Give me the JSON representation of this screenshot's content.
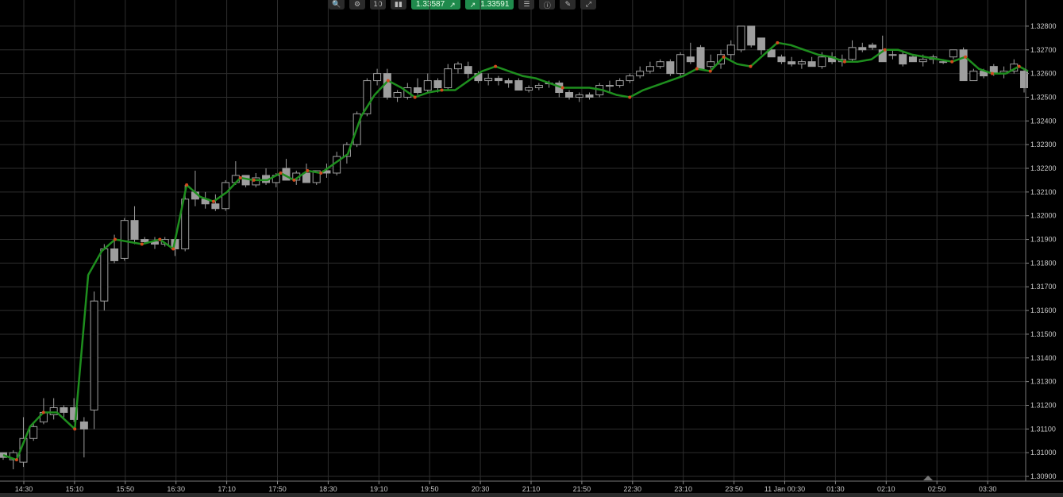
{
  "toolbar": {
    "zoom_icon": "magnifier-icon",
    "settings_icon": "chart-settings-icon",
    "timeframe_label": "10",
    "candles_icon": "candles-icon",
    "sell_price": "1.33587",
    "buy_price": "1.33591",
    "list_icon": "checklist-icon",
    "info_icon": "info-icon",
    "tools_icon": "drawing-tools-icon",
    "expand_icon": "expand-icon"
  },
  "colors": {
    "background": "#000000",
    "grid": "#2e2e2e",
    "candle": "#9e9e9e",
    "line": "#1e8e1e",
    "marker": "#d24a1e",
    "axis_text": "#c8c8c8",
    "price_button": "#1f8a4c"
  },
  "chart_data": {
    "type": "candlestick",
    "x_ticks": [
      "14:30",
      "15:10",
      "15:50",
      "16:30",
      "17:10",
      "17:50",
      "18:30",
      "19:10",
      "19:50",
      "20:30",
      "21:10",
      "21:50",
      "22:30",
      "23:10",
      "23:50",
      "11 Jan 00:30",
      "01:30",
      "02:10",
      "02:50",
      "03:30"
    ],
    "y_ticks": [
      "1.32800",
      "1.32700",
      "1.32600",
      "1.32500",
      "1.32400",
      "1.32300",
      "1.32200",
      "1.32100",
      "1.32000",
      "1.31900",
      "1.31800",
      "1.31700",
      "1.31600",
      "1.31500",
      "1.31400",
      "1.31300",
      "1.31200",
      "1.31100",
      "1.31000",
      "1.30900"
    ],
    "ylim": [
      1.3088,
      1.3285
    ],
    "grid": true,
    "candles": [
      {
        "o": 1.31,
        "h": 1.31,
        "l": 1.3097,
        "c": 1.3098
      },
      {
        "o": 1.3097,
        "h": 1.3101,
        "l": 1.3093,
        "c": 1.31
      },
      {
        "o": 1.3096,
        "h": 1.3115,
        "l": 1.3094,
        "c": 1.3106
      },
      {
        "o": 1.3106,
        "h": 1.3113,
        "l": 1.3105,
        "c": 1.3111
      },
      {
        "o": 1.3113,
        "h": 1.3123,
        "l": 1.3112,
        "c": 1.3117
      },
      {
        "o": 1.3116,
        "h": 1.3123,
        "l": 1.3114,
        "c": 1.3119
      },
      {
        "o": 1.3119,
        "h": 1.312,
        "l": 1.3115,
        "c": 1.3117
      },
      {
        "o": 1.3119,
        "h": 1.3123,
        "l": 1.3113,
        "c": 1.3114
      },
      {
        "o": 1.3113,
        "h": 1.3115,
        "l": 1.3098,
        "c": 1.311
      },
      {
        "o": 1.3118,
        "h": 1.3168,
        "l": 1.311,
        "c": 1.3164
      },
      {
        "o": 1.3164,
        "h": 1.3188,
        "l": 1.316,
        "c": 1.3186
      },
      {
        "o": 1.3186,
        "h": 1.3192,
        "l": 1.318,
        "c": 1.3181
      },
      {
        "o": 1.3182,
        "h": 1.3199,
        "l": 1.3181,
        "c": 1.3198
      },
      {
        "o": 1.3198,
        "h": 1.3204,
        "l": 1.3188,
        "c": 1.319
      },
      {
        "o": 1.319,
        "h": 1.3191,
        "l": 1.3188,
        "c": 1.3189
      },
      {
        "o": 1.3189,
        "h": 1.3191,
        "l": 1.3186,
        "c": 1.3188
      },
      {
        "o": 1.3188,
        "h": 1.3191,
        "l": 1.3187,
        "c": 1.319
      },
      {
        "o": 1.319,
        "h": 1.3191,
        "l": 1.3183,
        "c": 1.3186
      },
      {
        "o": 1.3186,
        "h": 1.3213,
        "l": 1.3185,
        "c": 1.3207
      },
      {
        "o": 1.321,
        "h": 1.3219,
        "l": 1.3204,
        "c": 1.3207
      },
      {
        "o": 1.3207,
        "h": 1.321,
        "l": 1.3203,
        "c": 1.3205
      },
      {
        "o": 1.3205,
        "h": 1.3209,
        "l": 1.3202,
        "c": 1.3203
      },
      {
        "o": 1.3203,
        "h": 1.3215,
        "l": 1.3202,
        "c": 1.3214
      },
      {
        "o": 1.3214,
        "h": 1.3223,
        "l": 1.3213,
        "c": 1.3217
      },
      {
        "o": 1.3217,
        "h": 1.3217,
        "l": 1.3212,
        "c": 1.3213
      },
      {
        "o": 1.3213,
        "h": 1.3218,
        "l": 1.3212,
        "c": 1.3216
      },
      {
        "o": 1.3217,
        "h": 1.322,
        "l": 1.3213,
        "c": 1.3214
      },
      {
        "o": 1.3214,
        "h": 1.3218,
        "l": 1.3212,
        "c": 1.3217
      },
      {
        "o": 1.322,
        "h": 1.3224,
        "l": 1.3215,
        "c": 1.3215
      },
      {
        "o": 1.3215,
        "h": 1.3219,
        "l": 1.3213,
        "c": 1.3218
      },
      {
        "o": 1.3218,
        "h": 1.3222,
        "l": 1.3214,
        "c": 1.3214
      },
      {
        "o": 1.3214,
        "h": 1.3219,
        "l": 1.3213,
        "c": 1.3219
      },
      {
        "o": 1.3219,
        "h": 1.3222,
        "l": 1.3216,
        "c": 1.3218
      },
      {
        "o": 1.3218,
        "h": 1.3227,
        "l": 1.3217,
        "c": 1.3225
      },
      {
        "o": 1.3225,
        "h": 1.3231,
        "l": 1.3222,
        "c": 1.323
      },
      {
        "o": 1.323,
        "h": 1.3244,
        "l": 1.3229,
        "c": 1.3243
      },
      {
        "o": 1.3243,
        "h": 1.3258,
        "l": 1.3242,
        "c": 1.3257
      },
      {
        "o": 1.3257,
        "h": 1.3262,
        "l": 1.3255,
        "c": 1.326
      },
      {
        "o": 1.326,
        "h": 1.3262,
        "l": 1.3249,
        "c": 1.325
      },
      {
        "o": 1.325,
        "h": 1.3253,
        "l": 1.3248,
        "c": 1.3252
      },
      {
        "o": 1.325,
        "h": 1.3256,
        "l": 1.3249,
        "c": 1.3254
      },
      {
        "o": 1.3254,
        "h": 1.3258,
        "l": 1.3251,
        "c": 1.3252
      },
      {
        "o": 1.3253,
        "h": 1.326,
        "l": 1.3252,
        "c": 1.3257
      },
      {
        "o": 1.3257,
        "h": 1.3258,
        "l": 1.3252,
        "c": 1.3254
      },
      {
        "o": 1.3254,
        "h": 1.3264,
        "l": 1.3253,
        "c": 1.3262
      },
      {
        "o": 1.3262,
        "h": 1.3265,
        "l": 1.326,
        "c": 1.3264
      },
      {
        "o": 1.3263,
        "h": 1.3265,
        "l": 1.3258,
        "c": 1.326
      },
      {
        "o": 1.326,
        "h": 1.3261,
        "l": 1.3256,
        "c": 1.3257
      },
      {
        "o": 1.3257,
        "h": 1.326,
        "l": 1.3255,
        "c": 1.3258
      },
      {
        "o": 1.3258,
        "h": 1.3259,
        "l": 1.3255,
        "c": 1.3257
      },
      {
        "o": 1.3257,
        "h": 1.3258,
        "l": 1.3254,
        "c": 1.3256
      },
      {
        "o": 1.3257,
        "h": 1.3258,
        "l": 1.3253,
        "c": 1.3253
      },
      {
        "o": 1.3253,
        "h": 1.3255,
        "l": 1.3252,
        "c": 1.3254
      },
      {
        "o": 1.3254,
        "h": 1.3256,
        "l": 1.3253,
        "c": 1.3255
      },
      {
        "o": 1.3256,
        "h": 1.3257,
        "l": 1.3254,
        "c": 1.3256
      },
      {
        "o": 1.3256,
        "h": 1.3257,
        "l": 1.325,
        "c": 1.3252
      },
      {
        "o": 1.3252,
        "h": 1.3253,
        "l": 1.3249,
        "c": 1.325
      },
      {
        "o": 1.325,
        "h": 1.3252,
        "l": 1.3248,
        "c": 1.3251
      },
      {
        "o": 1.3251,
        "h": 1.3252,
        "l": 1.3249,
        "c": 1.325
      },
      {
        "o": 1.3251,
        "h": 1.3256,
        "l": 1.325,
        "c": 1.3255
      },
      {
        "o": 1.3255,
        "h": 1.3257,
        "l": 1.3252,
        "c": 1.3255
      },
      {
        "o": 1.3255,
        "h": 1.3258,
        "l": 1.3254,
        "c": 1.3257
      },
      {
        "o": 1.3257,
        "h": 1.326,
        "l": 1.3256,
        "c": 1.3259
      },
      {
        "o": 1.3259,
        "h": 1.3263,
        "l": 1.3258,
        "c": 1.3261
      },
      {
        "o": 1.3261,
        "h": 1.3265,
        "l": 1.326,
        "c": 1.3263
      },
      {
        "o": 1.3263,
        "h": 1.3266,
        "l": 1.3262,
        "c": 1.3265
      },
      {
        "o": 1.3265,
        "h": 1.3266,
        "l": 1.3259,
        "c": 1.326
      },
      {
        "o": 1.326,
        "h": 1.3269,
        "l": 1.3259,
        "c": 1.3268
      },
      {
        "o": 1.3267,
        "h": 1.3273,
        "l": 1.3264,
        "c": 1.3265
      },
      {
        "o": 1.3271,
        "h": 1.3272,
        "l": 1.3262,
        "c": 1.3262
      },
      {
        "o": 1.3263,
        "h": 1.3268,
        "l": 1.3262,
        "c": 1.3265
      },
      {
        "o": 1.3264,
        "h": 1.327,
        "l": 1.3262,
        "c": 1.3268
      },
      {
        "o": 1.3268,
        "h": 1.3274,
        "l": 1.3266,
        "c": 1.3272
      },
      {
        "o": 1.327,
        "h": 1.328,
        "l": 1.3269,
        "c": 1.328
      },
      {
        "o": 1.328,
        "h": 1.328,
        "l": 1.3271,
        "c": 1.3272
      },
      {
        "o": 1.3275,
        "h": 1.3275,
        "l": 1.3268,
        "c": 1.327
      },
      {
        "o": 1.327,
        "h": 1.3271,
        "l": 1.3267,
        "c": 1.3267
      },
      {
        "o": 1.3267,
        "h": 1.3268,
        "l": 1.3264,
        "c": 1.3265
      },
      {
        "o": 1.3265,
        "h": 1.3267,
        "l": 1.3263,
        "c": 1.3264
      },
      {
        "o": 1.3264,
        "h": 1.3266,
        "l": 1.3262,
        "c": 1.3265
      },
      {
        "o": 1.3265,
        "h": 1.3267,
        "l": 1.3263,
        "c": 1.3263
      },
      {
        "o": 1.3263,
        "h": 1.3269,
        "l": 1.3262,
        "c": 1.3267
      },
      {
        "o": 1.3267,
        "h": 1.3269,
        "l": 1.3264,
        "c": 1.3265
      },
      {
        "o": 1.3265,
        "h": 1.3268,
        "l": 1.3263,
        "c": 1.3266
      },
      {
        "o": 1.3266,
        "h": 1.3274,
        "l": 1.3265,
        "c": 1.3271
      },
      {
        "o": 1.3271,
        "h": 1.3273,
        "l": 1.3269,
        "c": 1.327
      },
      {
        "o": 1.3272,
        "h": 1.3273,
        "l": 1.327,
        "c": 1.3271
      },
      {
        "o": 1.327,
        "h": 1.3276,
        "l": 1.3265,
        "c": 1.3265
      },
      {
        "o": 1.3268,
        "h": 1.327,
        "l": 1.3266,
        "c": 1.3268
      },
      {
        "o": 1.3268,
        "h": 1.3269,
        "l": 1.3263,
        "c": 1.3264
      },
      {
        "o": 1.3267,
        "h": 1.3268,
        "l": 1.3265,
        "c": 1.3265
      },
      {
        "o": 1.3265,
        "h": 1.3268,
        "l": 1.3263,
        "c": 1.3266
      },
      {
        "o": 1.3266,
        "h": 1.3268,
        "l": 1.3264,
        "c": 1.3267
      },
      {
        "o": 1.3265,
        "h": 1.3266,
        "l": 1.3264,
        "c": 1.3265
      },
      {
        "o": 1.3267,
        "h": 1.327,
        "l": 1.3266,
        "c": 1.327
      },
      {
        "o": 1.327,
        "h": 1.3271,
        "l": 1.3257,
        "c": 1.3257
      },
      {
        "o": 1.3257,
        "h": 1.3262,
        "l": 1.3257,
        "c": 1.3261
      },
      {
        "o": 1.3261,
        "h": 1.3262,
        "l": 1.3258,
        "c": 1.3259
      },
      {
        "o": 1.3263,
        "h": 1.3264,
        "l": 1.3259,
        "c": 1.326
      },
      {
        "o": 1.326,
        "h": 1.3263,
        "l": 1.3258,
        "c": 1.3261
      },
      {
        "o": 1.3261,
        "h": 1.3266,
        "l": 1.326,
        "c": 1.3264
      },
      {
        "o": 1.3261,
        "h": 1.3262,
        "l": 1.3252,
        "c": 1.3254
      }
    ],
    "line": [
      [
        0,
        1.3099
      ],
      [
        3,
        1.3097
      ],
      [
        6,
        1.3111
      ],
      [
        9,
        1.3117
      ],
      [
        12,
        1.3117
      ],
      [
        16,
        1.311
      ],
      [
        19,
        1.3175
      ],
      [
        22,
        1.3185
      ],
      [
        25,
        1.319
      ],
      [
        28,
        1.3189
      ],
      [
        31,
        1.3188
      ],
      [
        35,
        1.319
      ],
      [
        38,
        1.3186
      ],
      [
        41,
        1.3213
      ],
      [
        44,
        1.3208
      ],
      [
        47,
        1.3206
      ],
      [
        50,
        1.321
      ],
      [
        53,
        1.3216
      ],
      [
        56,
        1.3215
      ],
      [
        59,
        1.3215
      ],
      [
        62,
        1.3218
      ],
      [
        65,
        1.3215
      ],
      [
        68,
        1.3219
      ],
      [
        71,
        1.3218
      ],
      [
        74,
        1.3222
      ],
      [
        77,
        1.3226
      ],
      [
        80,
        1.3242
      ],
      [
        83,
        1.3251
      ],
      [
        86,
        1.3257
      ],
      [
        89,
        1.3254
      ],
      [
        92,
        1.325
      ],
      [
        95,
        1.3252
      ],
      [
        98,
        1.3253
      ],
      [
        101,
        1.3253
      ],
      [
        104,
        1.3257
      ],
      [
        107,
        1.3261
      ],
      [
        110,
        1.3263
      ],
      [
        113,
        1.3261
      ],
      [
        116,
        1.3259
      ],
      [
        119,
        1.3258
      ],
      [
        122,
        1.3256
      ],
      [
        125,
        1.3254
      ],
      [
        128,
        1.3254
      ],
      [
        131,
        1.3254
      ],
      [
        134,
        1.3253
      ],
      [
        137,
        1.3251
      ],
      [
        140,
        1.325
      ],
      [
        143,
        1.3253
      ],
      [
        146,
        1.3255
      ],
      [
        149,
        1.3257
      ],
      [
        152,
        1.3259
      ],
      [
        155,
        1.3262
      ],
      [
        158,
        1.3261
      ],
      [
        161,
        1.3267
      ],
      [
        164,
        1.3264
      ],
      [
        167,
        1.3263
      ],
      [
        170,
        1.3268
      ],
      [
        173,
        1.3273
      ],
      [
        176,
        1.3272
      ],
      [
        179,
        1.327
      ],
      [
        182,
        1.3268
      ],
      [
        185,
        1.3267
      ],
      [
        188,
        1.3265
      ],
      [
        191,
        1.3265
      ],
      [
        194,
        1.3266
      ],
      [
        197,
        1.327
      ],
      [
        200,
        1.327
      ],
      [
        203,
        1.3268
      ],
      [
        206,
        1.3267
      ],
      [
        209,
        1.3266
      ],
      [
        212,
        1.3265
      ],
      [
        215,
        1.3267
      ],
      [
        218,
        1.3262
      ],
      [
        221,
        1.326
      ],
      [
        224,
        1.326
      ],
      [
        227,
        1.3263
      ],
      [
        229,
        1.3261
      ]
    ]
  }
}
